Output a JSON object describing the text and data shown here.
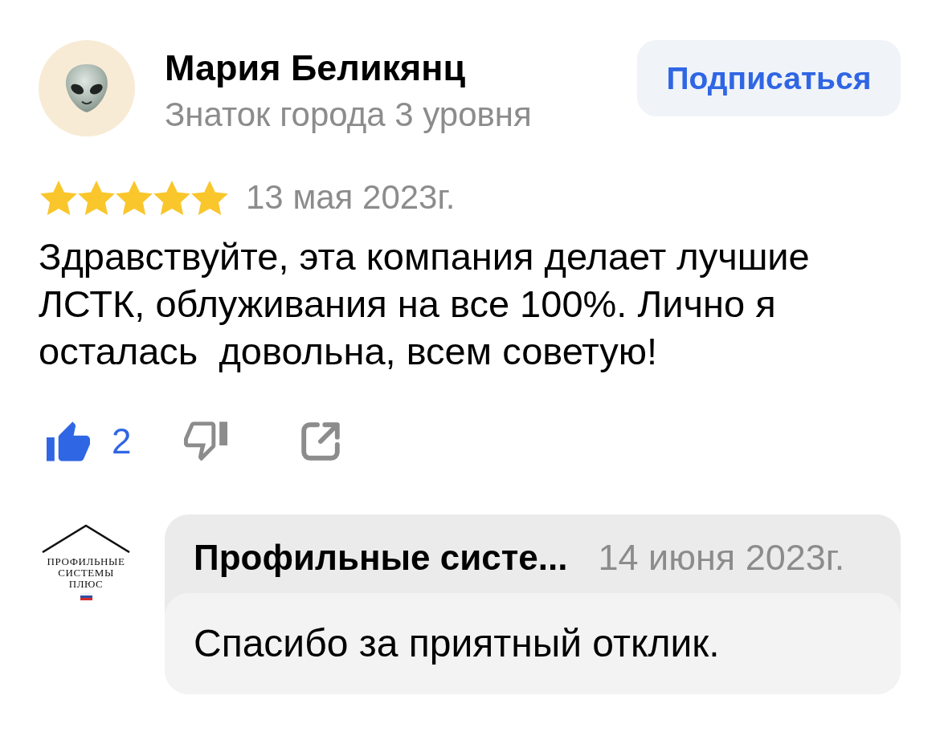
{
  "review": {
    "author": {
      "name": "Мария Беликянц",
      "level": "Знаток города 3 уровня"
    },
    "subscribe_button": {
      "label": "Подписаться"
    },
    "stars": 5,
    "date": "13 мая 2023г.",
    "text": "Здравствуйте, эта компания делает лучшие ЛСТК, облуживания на все 100%. Лично я осталась  довольна, всем советую!",
    "actions": [
      {
        "kind": "like",
        "count": "2",
        "selected": true
      },
      {
        "kind": "dislike",
        "selected": false
      },
      {
        "kind": "share"
      }
    ]
  },
  "reply": {
    "logo": {
      "lines": [
        "ПРОФИЛЬНЫЕ",
        "СИСТЕМЫ",
        "ПЛЮС"
      ]
    },
    "author": "Профильные систе...",
    "date": "14 июня 2023г.",
    "text": "Спасибо за приятный отклик."
  }
}
